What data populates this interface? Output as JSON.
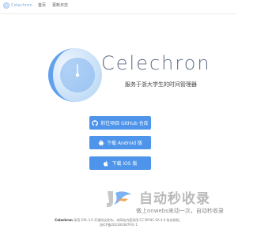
{
  "topbar": {
    "brand": "Celechron",
    "nav": [
      "首页",
      "更新日志"
    ]
  },
  "hero": {
    "title": "Celechron",
    "subtitle": "服务于浙大学生的时间管理器"
  },
  "buttons": {
    "github": "前往项目 GitHub 仓库",
    "android": "下载 Android 版",
    "ios": "下载 iOS 版"
  },
  "watermark": {
    "title": "自动秒收录",
    "subtitle": "做上onwebs来动一次，自动秒收录"
  },
  "footer": {
    "brand": "Celechron",
    "line1": "采用 GPL-3.0 开源协议发布。本网站内容采用 CC BY-NC-SA 4.0 协议授权。",
    "line2": "浙ICP备2023003870号-1"
  },
  "colors": {
    "accent": "#4d94ea",
    "title": "#5f6f86",
    "logo_light": "#d6e8fb",
    "logo_mid": "#8cbcf1"
  },
  "icons": {
    "github": "github-icon",
    "android": "android-icon",
    "ios": "apple-icon"
  }
}
